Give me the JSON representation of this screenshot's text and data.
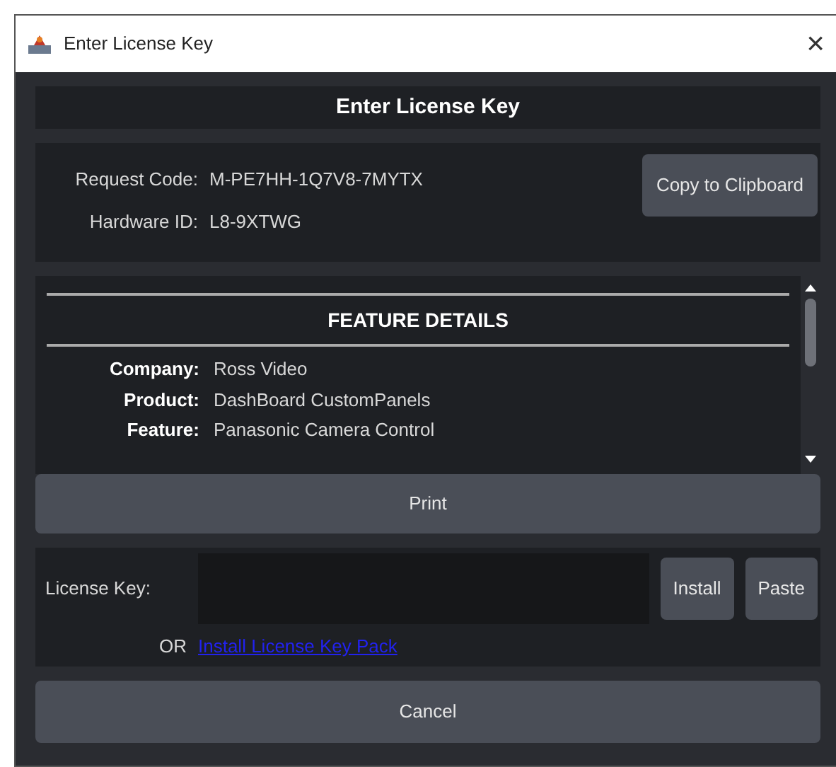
{
  "window": {
    "title": "Enter License Key",
    "close": "×"
  },
  "header": "Enter License Key",
  "request": {
    "label": "Request Code:",
    "value": "M-PE7HH-1Q7V8-7MYTX",
    "copy_button": "Copy to Clipboard"
  },
  "hardware": {
    "label": "Hardware ID:",
    "value": "L8-9XTWG"
  },
  "features": {
    "title": "FEATURE DETAILS",
    "rows": [
      {
        "label": "Company:",
        "value": "Ross Video"
      },
      {
        "label": "Product:",
        "value": "DashBoard CustomPanels"
      },
      {
        "label": "Feature:",
        "value": "Panasonic Camera Control"
      }
    ]
  },
  "print_button": "Print",
  "license": {
    "label": "License Key:",
    "install_button": "Install",
    "paste_button": "Paste",
    "or": "OR",
    "link": "Install License Key Pack"
  },
  "cancel_button": "Cancel"
}
